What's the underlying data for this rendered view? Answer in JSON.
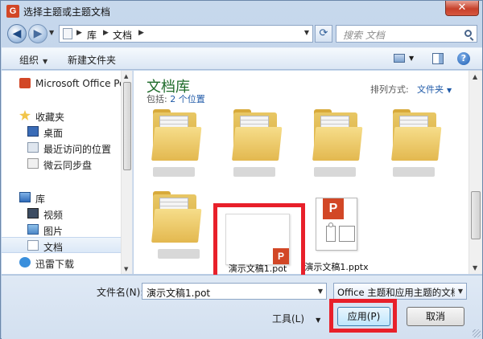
{
  "window": {
    "title": "选择主题或主题文档",
    "close_label": "✕",
    "app_icon_glyph": "G"
  },
  "nav": {
    "breadcrumb": [
      "库",
      "文档"
    ],
    "search_placeholder": "搜索 文档"
  },
  "toolbar": {
    "organize_label": "组织",
    "new_folder_label": "新建文件夹"
  },
  "sidebar": {
    "items": [
      {
        "label": "Microsoft Office Pow",
        "icon": "office-icon"
      },
      {
        "label": "收藏夹",
        "icon": "star-icon"
      },
      {
        "label": "桌面",
        "icon": "desktop-icon"
      },
      {
        "label": "最近访问的位置",
        "icon": "recent-places-icon"
      },
      {
        "label": "微云同步盘",
        "icon": "cloud-sync-icon"
      },
      {
        "label": "库",
        "icon": "library-icon"
      },
      {
        "label": "视频",
        "icon": "video-icon"
      },
      {
        "label": "图片",
        "icon": "picture-icon"
      },
      {
        "label": "文档",
        "icon": "document-icon",
        "selected": true
      },
      {
        "label": "迅雷下载",
        "icon": "thunder-icon"
      }
    ]
  },
  "main": {
    "library_title": "文档库",
    "includes_label": "包括:",
    "includes_link": "2 个位置",
    "arrange_label": "排列方式:",
    "arrange_value": "文件夹",
    "files": [
      {
        "name": "演示文稿1.pot",
        "type": "pot",
        "badge": "P"
      },
      {
        "name": "演示文稿1.pptx",
        "type": "pptx",
        "badge": "P"
      }
    ]
  },
  "bottom": {
    "filename_label": "文件名(N):",
    "filename_value": "演示文稿1.pot",
    "filetype_value": "Office 主题和应用主题的文档 (",
    "tools_label": "工具(L)",
    "apply_label": "应用(P)",
    "cancel_label": "取消"
  },
  "colors": {
    "highlight": "#e8202a",
    "office_orange": "#d24726",
    "library_title_green": "#1e6b2a",
    "link_blue": "#1f5aa8"
  }
}
